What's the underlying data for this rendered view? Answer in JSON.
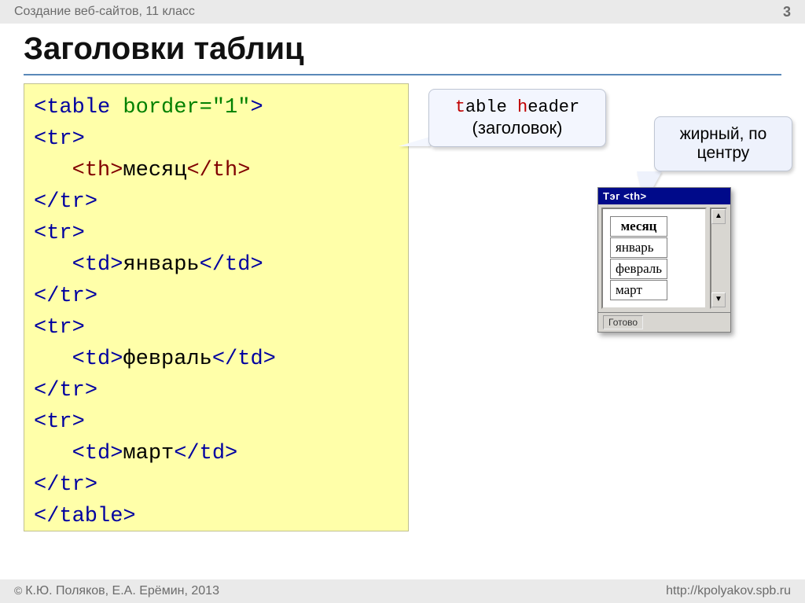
{
  "header": {
    "course": "Создание веб-сайтов, 11 класс",
    "page": "3"
  },
  "title": "Заголовки таблиц",
  "code": {
    "table_open_tag": "table",
    "table_attr_name": "border",
    "table_attr_value": "\"1\"",
    "tr": "tr",
    "th": "th",
    "td": "td",
    "table_close": "table",
    "cell_header": "месяц",
    "cell1": "январь",
    "cell2": "февраль",
    "cell3": "март",
    "indent": "   "
  },
  "callout1": {
    "mono_pre": "able ",
    "mono_post": "eader",
    "letter_t": "t",
    "letter_h": "h",
    "subtitle": "(заголовок)"
  },
  "callout2": {
    "line1": "жирный, по",
    "line2": "центру"
  },
  "browser": {
    "title": "Тэг <th>",
    "status": "Готово",
    "table": {
      "header": "месяц",
      "rows": [
        "январь",
        "февраль",
        "март"
      ]
    }
  },
  "footer": {
    "authors": "К.Ю. Поляков, Е.А. Ерёмин, 2013",
    "url": "http://kpolyakov.spb.ru"
  }
}
